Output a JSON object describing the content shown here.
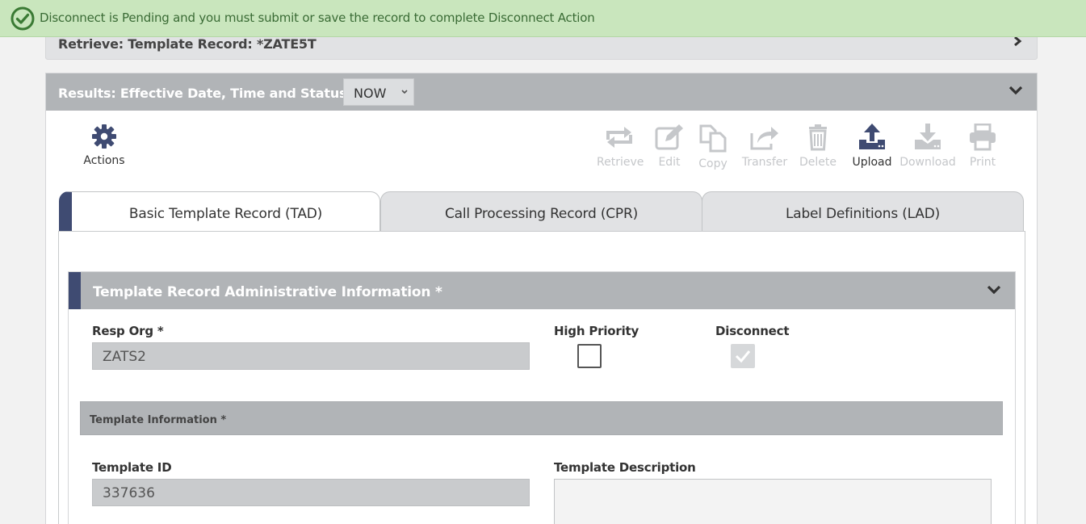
{
  "notice": {
    "message": "Disconnect is Pending and you must submit or save the record to complete Disconnect Action",
    "color": "#3a6b35"
  },
  "retrieve": {
    "title": "Retrieve: Template Record: *ZATE5T"
  },
  "results": {
    "title": "Results: Effective Date, Time and Status:",
    "status_value": "NOW"
  },
  "actions": {
    "label": "Actions"
  },
  "toolbar": {
    "retrieve": "Retrieve",
    "edit": "Edit",
    "copy": "Copy",
    "transfer": "Transfer",
    "delete": "Delete",
    "upload": "Upload",
    "download": "Download",
    "print": "Print"
  },
  "tabs": [
    {
      "label": "Basic Template Record (TAD)",
      "active": true
    },
    {
      "label": "Call Processing Record (CPR)",
      "active": false
    },
    {
      "label": "Label Definitions (LAD)",
      "active": false
    }
  ],
  "section": {
    "title": "Template Record Administrative Information *",
    "resp_org_label": "Resp Org *",
    "resp_org_value": "ZATS2",
    "high_priority_label": "High Priority",
    "high_priority_checked": false,
    "disconnect_label": "Disconnect",
    "disconnect_checked": true
  },
  "template_info": {
    "title": "Template Information *",
    "template_id_label": "Template ID",
    "template_id_value": "337636",
    "template_desc_label": "Template Description",
    "template_desc_value": ""
  },
  "colors": {
    "accent": "#3f4b72",
    "header_gray": "#b1b4b7",
    "notice_bg": "#c9e6bd"
  }
}
